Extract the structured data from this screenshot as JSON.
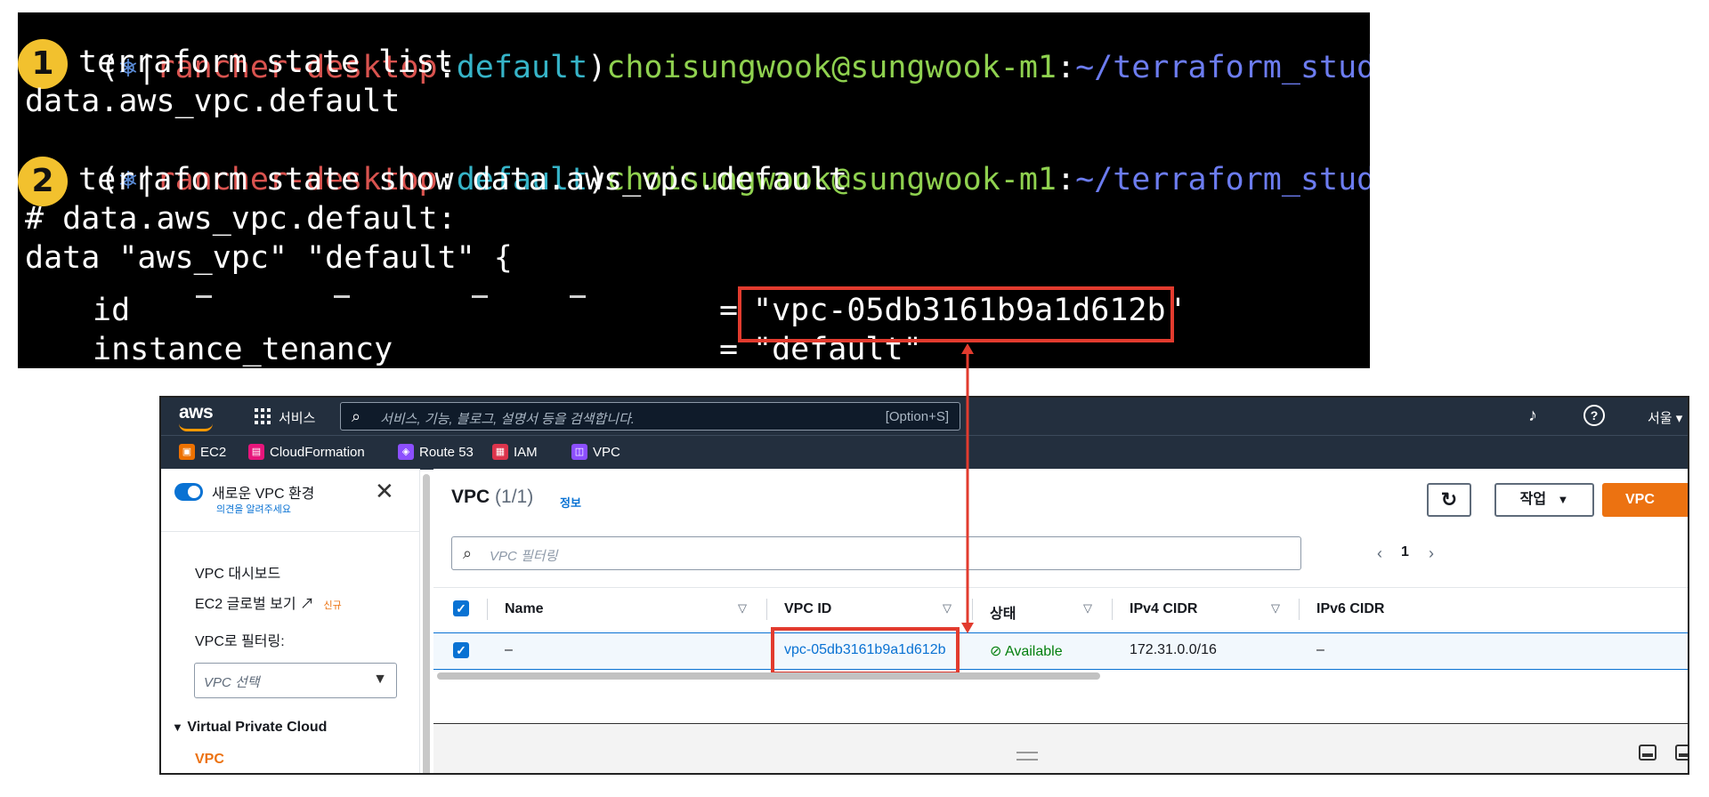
{
  "terminal": {
    "prompt": {
      "open": "(",
      "k8s_glyph": "⎈",
      "sep": "|",
      "context": "rancher-desktop",
      "colon": ":",
      "namespace": "default",
      "close": ")",
      "user_host": "choisungwook@sungwook-m1",
      "path_sep": ":",
      "path": "~/terraform_study"
    },
    "steps": [
      "1",
      "2"
    ],
    "cmd1": "terraform state list",
    "out1": "data.aws_vpc.default",
    "cmd2": "terraform state show data.aws_vpc.default",
    "out2_comment": "# data.aws_vpc.default:",
    "out2_block": "data \"aws_vpc\" \"default\" {",
    "attr_id_name": "id",
    "attr_eq": "=",
    "attr_id_value": "\"vpc-05db3161b9a1d612b\"",
    "attr_tenancy_name": "instance_tenancy",
    "attr_tenancy_value": "\"default\""
  },
  "aws": {
    "logo": "aws",
    "services": "서비스",
    "search_placeholder": "서비스, 기능, 블로그, 설명서 등을 검색합니다.",
    "search_shortcut": "[Option+S]",
    "region": "서울 ▾",
    "favorites": [
      {
        "label": "EC2",
        "color": "#ed7100",
        "icon": "ec2-icon"
      },
      {
        "label": "CloudFormation",
        "color": "#e7157b",
        "icon": "cloudformation-icon"
      },
      {
        "label": "Route 53",
        "color": "#8c4fff",
        "icon": "route53-icon"
      },
      {
        "label": "IAM",
        "color": "#dd344c",
        "icon": "iam-icon"
      },
      {
        "label": "VPC",
        "color": "#8c4fff",
        "icon": "vpc-icon"
      }
    ],
    "nav": {
      "toggle_label": "새로운 VPC 환경",
      "feedback": "의견을 알려주세요",
      "dashboard": "VPC 대시보드",
      "ec2_global": "EC2 글로벌 보기",
      "new_tag": "신규",
      "filter_label": "VPC로 필터링:",
      "select_placeholder": "VPC 선택",
      "group": "Virtual Private Cloud",
      "active_item": "VPC"
    },
    "main": {
      "title": "VPC",
      "count": "(1/1)",
      "info": "정보",
      "actions_label": "작업",
      "primary_label": "VPC",
      "filter_placeholder": "VPC 필터링",
      "page": "1",
      "columns": [
        "Name",
        "VPC ID",
        "상태",
        "IPv4 CIDR",
        "IPv6 CIDR"
      ],
      "row": {
        "name": "–",
        "vpc_id": "vpc-05db3161b9a1d612b",
        "status": "Available",
        "ipv4": "172.31.0.0/16",
        "ipv6": "–"
      }
    },
    "accent": "#ec7211",
    "link_color": "#0972d3",
    "highlight_color": "#e23b2e"
  }
}
